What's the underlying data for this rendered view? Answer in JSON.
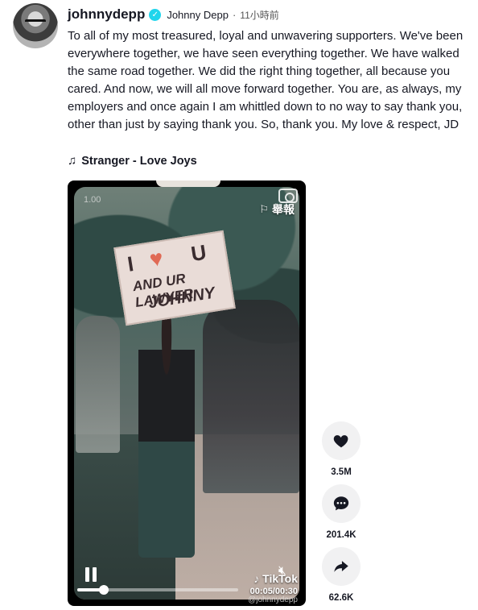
{
  "post": {
    "username": "johnnydepp",
    "nickname": "Johnny Depp",
    "separator": "·",
    "time_ago": "11小時前",
    "caption": "To all of my most treasured, loyal and unwavering supporters. We've been everywhere together, we have seen everything together. We have walked the same road together. We did the right thing together, all because you cared. And now, we will all move forward together. You are, as always, my employers and once again I am whittled down to no way to say thank you, other than just by saying thank you. So, thank you. My love & respect, JD",
    "music": "Stranger - Love Joys"
  },
  "video": {
    "aspect_label": "1.00",
    "report_label": "舉報",
    "sign_lines": [
      "I",
      "U",
      "AND UR LAWYER",
      "JOHNNY"
    ],
    "brand": "TikTok",
    "time": "00:05/00:30",
    "watermark": "@johnnydepp",
    "progress_fraction": 0.167
  },
  "actions": {
    "likes": "3.5M",
    "comments": "201.4K",
    "shares": "62.6K"
  },
  "icons": {
    "verified": "verified-check-icon",
    "music": "music-note-icon",
    "report": "flag-icon",
    "camera": "camera-icon",
    "pause": "pause-icon",
    "mute": "mute-icon",
    "like": "heart-icon",
    "comment": "comment-icon",
    "share": "share-arrow-icon"
  },
  "colors": {
    "verified": "#20d5ec",
    "action_bg": "#f1f1f2",
    "text": "#161823"
  }
}
